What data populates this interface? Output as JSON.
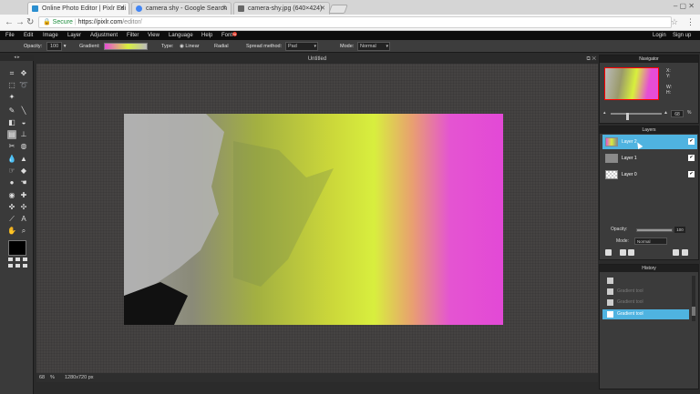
{
  "browser": {
    "tabs": [
      {
        "title": "Online Photo Editor | Pixlr Edi",
        "active": true,
        "favicon_color": "#2b8fd0"
      },
      {
        "title": "camera shy - Google Search",
        "active": false,
        "favicon_color": "#4285f4"
      },
      {
        "title": "camera-shy.jpg (640×424)",
        "active": false,
        "favicon_color": "#666666"
      }
    ],
    "address": {
      "secure_label": "Secure",
      "url_host": "https://pixlr.com",
      "url_path": "/editor/"
    }
  },
  "menu": {
    "items": [
      "File",
      "Edit",
      "Image",
      "Layer",
      "Adjustment",
      "Filter",
      "View",
      "Language",
      "Help",
      "Font"
    ],
    "font_badge": "N",
    "account": [
      "Login",
      "Sign up"
    ]
  },
  "options": {
    "opacity_label": "Opacity:",
    "opacity_value": "100",
    "gradient_label": "Gradient:",
    "type_label": "Type:",
    "type_linear": "Linear",
    "type_radial": "Radial",
    "spread_label": "Spread method:",
    "spread_value": "Pad",
    "mode_label": "Mode:",
    "mode_value": "Normal"
  },
  "document": {
    "title": "Untitled",
    "zoom": "68",
    "zoom_unit": "%",
    "dimensions": "1280x720 px"
  },
  "navigator": {
    "title": "Navigator",
    "labels": [
      "X:",
      "Y:",
      "W:",
      "H:"
    ],
    "zoom_value": "68"
  },
  "layers": {
    "title": "Layers",
    "items": [
      {
        "name": "Layer 2",
        "active": true
      },
      {
        "name": "Layer 1",
        "active": false
      },
      {
        "name": "Layer 0",
        "active": false
      }
    ],
    "opacity_label": "Opacity:",
    "opacity_value": "100",
    "mode_label": "Mode:",
    "mode_value": "Normal"
  },
  "history": {
    "title": "History",
    "items": [
      {
        "label": "",
        "state": "normal"
      },
      {
        "label": "Gradient tool",
        "state": "faded"
      },
      {
        "label": "Gradient tool",
        "state": "faded"
      },
      {
        "label": "Gradient tool",
        "state": "active"
      }
    ]
  },
  "colors": {
    "accent": "#4fb3e0",
    "gradient_start": "#e64dd6",
    "gradient_mid": "#d8f03c"
  }
}
